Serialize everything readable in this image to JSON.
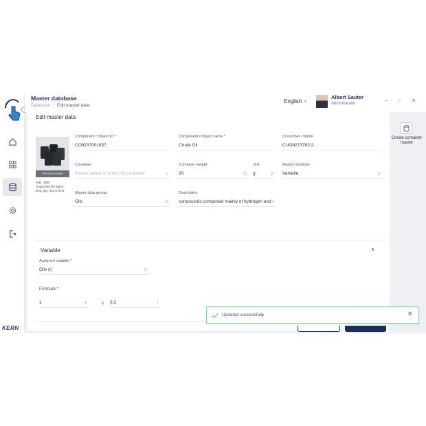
{
  "header": {
    "title": "Master database",
    "breadcrumb": [
      "Database",
      "Edit master data"
    ],
    "language": "English",
    "user_name": "Albert Sauter",
    "user_role": "Administrator"
  },
  "rail": {
    "items": [
      "home-icon",
      "grid-icon",
      "database-icon",
      "settings-icon",
      "logout-icon"
    ],
    "active_index": 2,
    "brand": "KERN"
  },
  "card": {
    "title": "Edit master data",
    "image": {
      "remove_label": "Remove image",
      "note_line1": "Max. 2MB",
      "note_line2": "Supported file types:",
      "note_line3": "jpeg, jpg, png & bmp"
    },
    "fields": {
      "component_id": {
        "label": "Component / Object ID *",
        "value": "CO9237001837"
      },
      "component_name": {
        "label": "Component / Object name *",
        "value": "Crude Oil"
      },
      "id_number": {
        "label": "ID number / Name",
        "value": "CUO927378211"
      },
      "container": {
        "label": "Container",
        "placeholder": "Please select or enter the container"
      },
      "container_weight": {
        "label": "Container weight",
        "value": "20"
      },
      "unit": {
        "label": "Unit",
        "value": "g"
      },
      "assign_functions": {
        "label": "Assign functions",
        "value": "Variable"
      },
      "master_data_groups": {
        "label": "Master data groups",
        "value": "Oils"
      },
      "description": {
        "label": "Description",
        "value": "compounds composed mainly of hydrogen and c"
      }
    },
    "variable_section": {
      "title": "Variable",
      "assigned_variable": {
        "label": "Assigned variable *",
        "value": "Oils (l)"
      },
      "formula_label": "Formula *",
      "formula_left_value": "1",
      "formula_left_unit": "£",
      "formula_operator": "x",
      "formula_right_value": "0.2",
      "formula_right_unit": "l"
    }
  },
  "right_rail": {
    "create_label": "Create container master"
  },
  "toast": {
    "message": "Updated successfully"
  },
  "colors": {
    "brand_navy": "#1f2d5a",
    "success_green": "#8fd19e",
    "panel_bg": "#eff0f3"
  }
}
